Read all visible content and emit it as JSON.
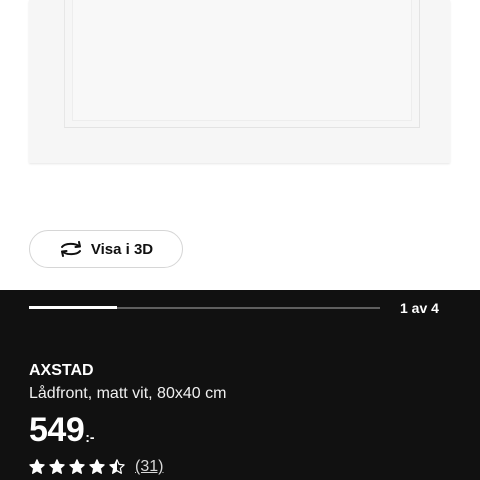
{
  "gallery": {
    "view_3d_label": "Visa i 3D",
    "view_3d_icon": "rotate-3d-icon",
    "pager_text": "1 av 4",
    "progress_fraction": 0.25
  },
  "product": {
    "name": "AXSTAD",
    "description": "Lådfront, matt vit, 80x40 cm",
    "price_amount": "549",
    "price_suffix": ":-",
    "rating": 4.5,
    "rating_max": 5,
    "review_count_text": "(31)"
  },
  "colors": {
    "panel_bg": "#111111",
    "text": "#ffffff"
  }
}
